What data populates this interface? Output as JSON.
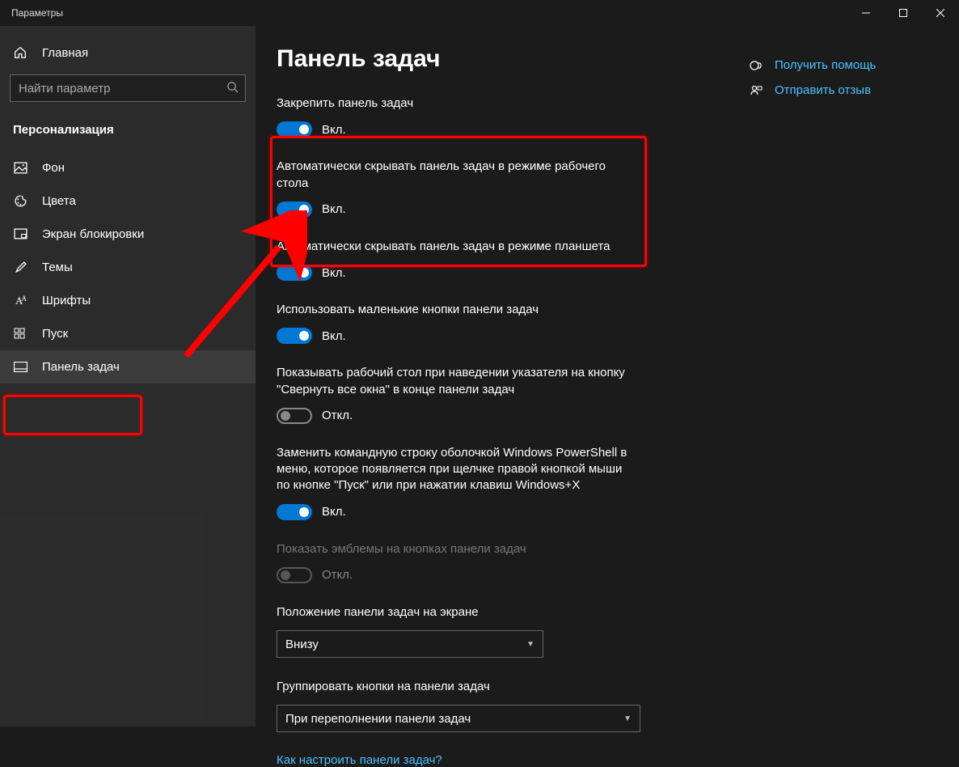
{
  "window": {
    "title": "Параметры"
  },
  "sidebar": {
    "home": "Главная",
    "search_placeholder": "Найти параметр",
    "section": "Персонализация",
    "items": [
      {
        "label": "Фон"
      },
      {
        "label": "Цвета"
      },
      {
        "label": "Экран блокировки"
      },
      {
        "label": "Темы"
      },
      {
        "label": "Шрифты"
      },
      {
        "label": "Пуск"
      },
      {
        "label": "Панель задач"
      }
    ]
  },
  "page": {
    "title": "Панель задач",
    "settings": {
      "lock": {
        "label": "Закрепить панель задач",
        "state": "Вкл."
      },
      "hide_desktop": {
        "label": "Автоматически скрывать панель задач в режиме рабочего стола",
        "state": "Вкл."
      },
      "hide_tablet": {
        "label": "Автоматически скрывать панель задач в режиме планшета",
        "state": "Вкл."
      },
      "small_buttons": {
        "label": "Использовать маленькие кнопки панели задач",
        "state": "Вкл."
      },
      "peek": {
        "label": "Показывать рабочий стол при наведении указателя на кнопку \"Свернуть все окна\" в конце панели задач",
        "state": "Откл."
      },
      "powershell": {
        "label": "Заменить командную строку оболочкой Windows PowerShell в меню, которое появляется при щелчке правой кнопкой мыши по кнопке \"Пуск\" или при нажатии клавиш Windows+X",
        "state": "Вкл."
      },
      "badges": {
        "label": "Показать эмблемы на кнопках панели задач",
        "state": "Откл."
      },
      "position": {
        "label": "Положение панели задач на экране",
        "value": "Внизу"
      },
      "grouping": {
        "label": "Группировать кнопки на панели задач",
        "value": "При переполнении панели задач"
      }
    },
    "help_link": "Как настроить панели задач?"
  },
  "aside": {
    "help": "Получить помощь",
    "feedback": "Отправить отзыв"
  },
  "toggle_states": {
    "on": "Вкл.",
    "off": "Откл."
  }
}
